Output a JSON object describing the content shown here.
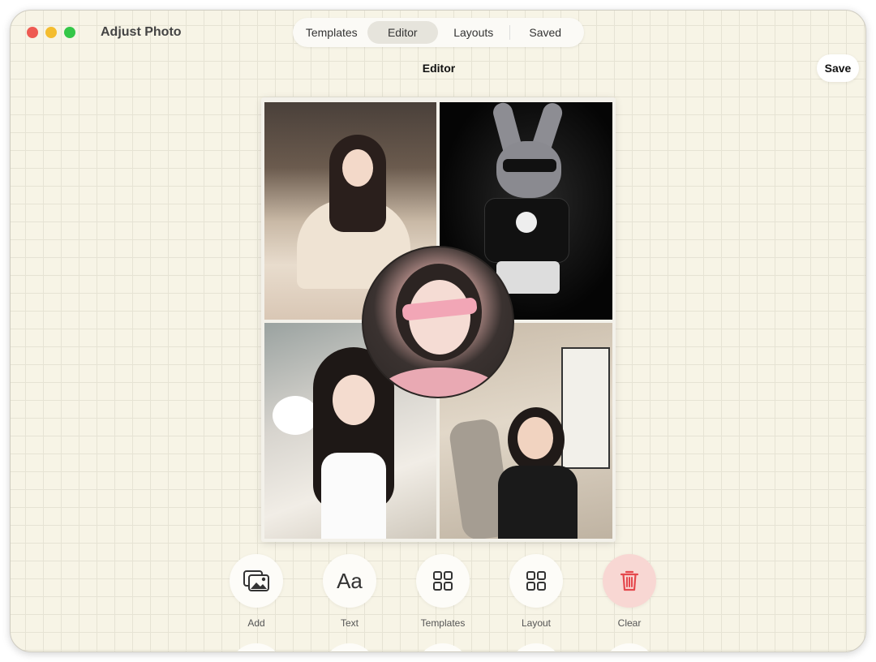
{
  "window": {
    "title": "Adjust Photo"
  },
  "nav": {
    "tabs": [
      {
        "label": "Templates",
        "active": false
      },
      {
        "label": "Editor",
        "active": true
      },
      {
        "label": "Layouts",
        "active": false
      },
      {
        "label": "Saved",
        "active": false
      }
    ]
  },
  "editor": {
    "heading": "Editor",
    "save_label": "Save"
  },
  "toolbar": {
    "items": [
      {
        "label": "Add",
        "icon": "photo-add-icon"
      },
      {
        "label": "Text",
        "icon": "text-icon",
        "glyph": "Aa"
      },
      {
        "label": "Templates",
        "icon": "grid-icon"
      },
      {
        "label": "Layout",
        "icon": "grid-icon"
      },
      {
        "label": "Clear",
        "icon": "trash-icon",
        "color": "#e5484d"
      }
    ]
  },
  "colors": {
    "background": "#f7f4e6",
    "grid": "#e6e3d4",
    "active_tab": "#e6e4dc",
    "danger_bg": "#f8d7d3",
    "danger": "#e5484d"
  }
}
